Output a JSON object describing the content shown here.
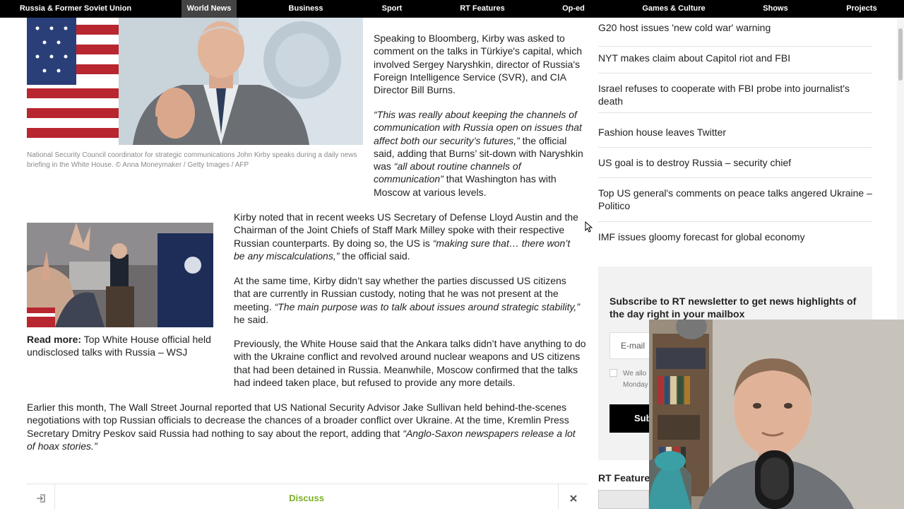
{
  "nav": {
    "items": [
      {
        "label": "Russia & Former Soviet Union",
        "active": false
      },
      {
        "label": "World News",
        "active": true
      },
      {
        "label": "Business",
        "active": false
      },
      {
        "label": "Sport",
        "active": false
      },
      {
        "label": "RT Features",
        "active": false
      },
      {
        "label": "Op-ed",
        "active": false
      },
      {
        "label": "Games & Culture",
        "active": false
      },
      {
        "label": "Shows",
        "active": false
      },
      {
        "label": "Projects",
        "active": false
      }
    ]
  },
  "article": {
    "image1_caption": "National Security Council coordinator for strategic communications John Kirby speaks during a daily news briefing in the White House. © Anna Moneymaker / Getty Images / AFP",
    "p1": "Speaking to Bloomberg, Kirby was asked to comment on the talks in Türkiye's capital, which involved Sergey Naryshkin, director of Russia's Foreign Intelligence Service (SVR), and CIA Director Bill Burns.",
    "p2_quote1": "“This was really about keeping the channels of communication with Russia open on issues that affect both our security’s futures,”",
    "p2_text1": " the official said, adding that Burns’ sit-down with Naryshkin was ",
    "p2_quote2": "“all about routine channels of communication”",
    "p2_text2": " that Washington has with Moscow at various levels.",
    "p3_text1": "Kirby noted that in recent weeks US Secretary of Defense Lloyd Austin and the Chairman of the Joint Chiefs of Staff Mark Milley spoke with their respective Russian counterparts. By doing so, the US is ",
    "p3_quote": "“making sure that… there won’t be any miscalculations,”",
    "p3_text2": " the official said.",
    "p4_text1": "At the same time, Kirby didn’t say whether the parties discussed US citizens that are currently in Russian custody, noting that he was not present at the meeting. ",
    "p4_quote": "“The main purpose was to talk about issues around strategic stability,”",
    "p4_text2": " he said.",
    "p5": "Previously, the White House said that the Ankara talks didn’t have anything to do with the Ukraine conflict and revolved around nuclear weapons and US citizens that had been detained in Russia. Meanwhile, Moscow confirmed that the talks had indeed taken place, but refused to provide any more details.",
    "p6_text": "Earlier this month, The Wall Street Journal reported that US National Security Advisor Jake Sullivan held behind-the-scenes negotiations with top Russian officials to decrease the chances of a broader conflict over Ukraine. At the time, Kremlin Press Secretary Dmitry Peskov said Russia had nothing to say about the report, adding that ",
    "p6_quote": "“Anglo-Saxon newspapers release a lot of hoax stories.”",
    "read_more_label": "Read more:",
    "read_more_link": "Top White House official held undisclosed talks with Russia – WSJ"
  },
  "discuss": {
    "label": "Discuss",
    "login_icon": "login-icon",
    "close_icon": "close-icon"
  },
  "sidebar": {
    "headlines": [
      "G20 host issues 'new cold war' warning",
      "NYT makes claim about Capitol riot and FBI",
      "Israel refuses to cooperate with FBI probe into journalist's death",
      "Fashion house leaves Twitter",
      "US goal is to destroy Russia – security chief",
      "Top US general's comments on peace talks angered Ukraine – Politico",
      "IMF issues gloomy forecast for global economy"
    ],
    "newsletter": {
      "title": "Subscribe to RT newsletter to get news highlights of the day right in your mailbox",
      "email_placeholder": "E-mail",
      "consent_text": "We allo",
      "consent_text2": "Monday",
      "subscribe_label": "Sub"
    },
    "features_title": "RT Feature"
  },
  "colors": {
    "nav_bg": "#000000",
    "nav_active": "#444444",
    "discuss_green": "#7bb026",
    "newsletter_bg": "#f2f2f2"
  }
}
